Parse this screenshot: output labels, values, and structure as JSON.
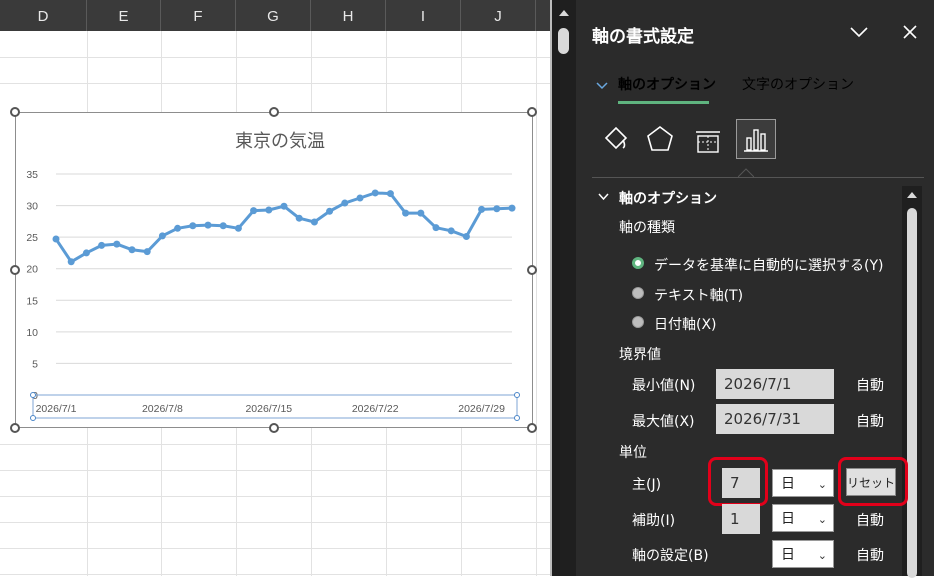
{
  "sheet": {
    "columns": [
      "D",
      "E",
      "F",
      "G",
      "H",
      "I",
      "J"
    ]
  },
  "chart_data": {
    "type": "line",
    "title": "東京の気温",
    "x_tick_labels": [
      "2026/7/1",
      "2026/7/8",
      "2026/7/15",
      "2026/7/22",
      "2026/7/29"
    ],
    "y_ticks": [
      0,
      5,
      10,
      15,
      20,
      25,
      30,
      35
    ],
    "ylim": [
      0,
      35
    ],
    "x_start": "2026/7/1",
    "x_end": "2026/7/31",
    "series": [
      {
        "color": "#5b9bd5",
        "x": [
          "2026/7/1",
          "2026/7/2",
          "2026/7/3",
          "2026/7/4",
          "2026/7/5",
          "2026/7/6",
          "2026/7/7",
          "2026/7/8",
          "2026/7/9",
          "2026/7/10",
          "2026/7/11",
          "2026/7/12",
          "2026/7/13",
          "2026/7/14",
          "2026/7/15",
          "2026/7/16",
          "2026/7/17",
          "2026/7/18",
          "2026/7/19",
          "2026/7/20",
          "2026/7/21",
          "2026/7/22",
          "2026/7/23",
          "2026/7/24",
          "2026/7/25",
          "2026/7/26",
          "2026/7/27",
          "2026/7/28",
          "2026/7/29",
          "2026/7/30",
          "2026/7/31"
        ],
        "values": [
          24.7,
          21.1,
          22.5,
          23.7,
          23.9,
          23.0,
          22.7,
          25.2,
          26.4,
          26.8,
          26.9,
          26.8,
          26.4,
          29.2,
          29.3,
          29.9,
          28.0,
          27.4,
          29.1,
          30.4,
          31.2,
          32.0,
          31.9,
          28.8,
          28.8,
          26.5,
          26.0,
          25.1,
          29.4,
          29.5,
          29.6
        ]
      }
    ],
    "grid": true
  },
  "panel": {
    "title": "軸の書式設定",
    "tabs": [
      {
        "label": "軸のオプション",
        "active": true
      },
      {
        "label": "文字のオプション",
        "active": false
      }
    ],
    "icons": [
      "fill-line-icon",
      "effects-pentagon-icon",
      "size-properties-icon",
      "bar-chart-icon"
    ],
    "section_title": "軸のオプション",
    "axis_type": {
      "label": "軸の種類",
      "options": [
        {
          "label": "データを基準に自動的に選択する(Y)",
          "selected": true
        },
        {
          "label": "テキスト軸(T)",
          "selected": false
        },
        {
          "label": "日付軸(X)",
          "selected": false
        }
      ]
    },
    "bounds": {
      "label": "境界値",
      "min_label": "最小値(N)",
      "min_value": "2026/7/1",
      "min_auto": "自動",
      "max_label": "最大値(X)",
      "max_value": "2026/7/31",
      "max_auto": "自動"
    },
    "units": {
      "label": "単位",
      "major_label": "主(J)",
      "major_value": "7",
      "major_unit": "日",
      "reset_label": "リセット",
      "minor_label": "補助(I)",
      "minor_value": "1",
      "minor_unit": "日",
      "minor_auto": "自動",
      "base_label": "軸の設定(B)",
      "base_unit": "日",
      "base_auto": "自動"
    }
  }
}
